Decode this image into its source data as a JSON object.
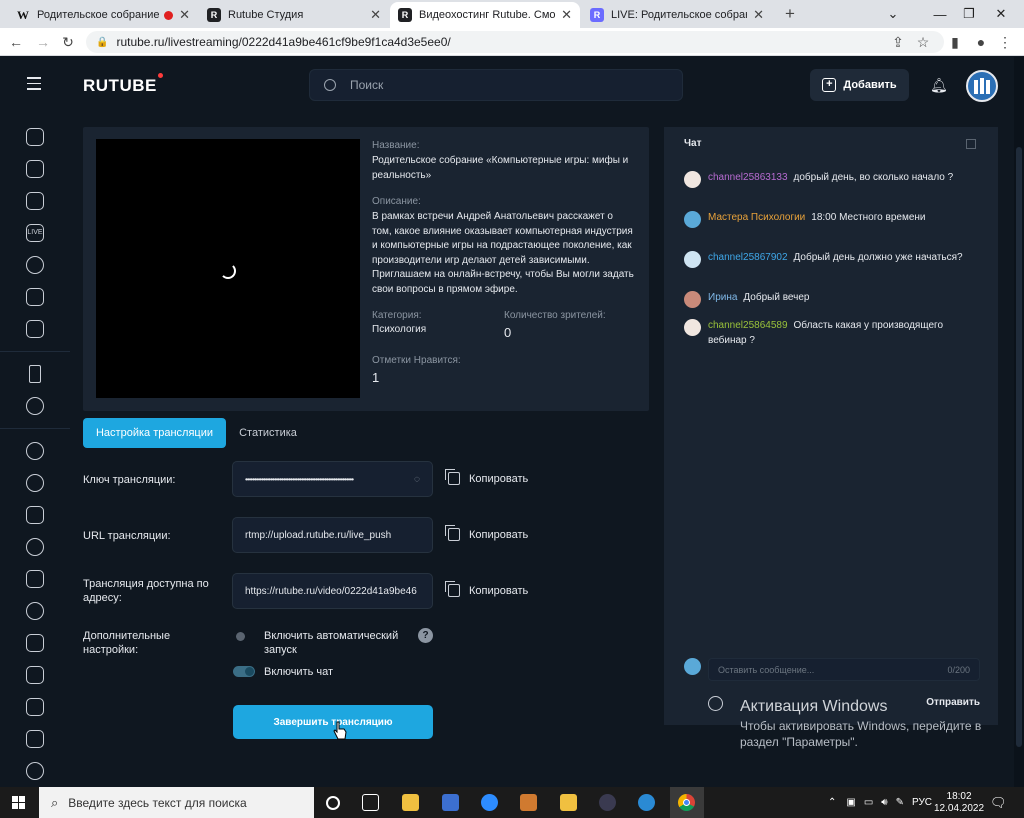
{
  "browser": {
    "tabs": [
      {
        "title": "Родительское собрание «К",
        "favicon": "W"
      },
      {
        "title": "Rutube Студия",
        "favicon": "R"
      },
      {
        "title": "Видеохостинг Rutube. Смотрите",
        "favicon": "R"
      },
      {
        "title": "LIVE: Родительское собрание «К",
        "favicon": "R"
      }
    ],
    "new_tab": "+",
    "url": "rutube.ru/livestreaming/0222d41a9be461cf9be9f1ca4d3e5ee0/"
  },
  "header": {
    "logo": "RUTUBE",
    "search_placeholder": "Поиск",
    "add_label": "Добавить"
  },
  "stream": {
    "name_label": "Название:",
    "name_value": "Родительское собрание «Компьютерные игры: мифы и реальность»",
    "desc_label": "Описание:",
    "desc_value": "В рамках встречи Андрей Анатольевич расскажет о том, какое влияние оказывает компьютерная индустрия и компьютерные игры на подрастающее поколение, как производители игр делают детей зависимыми. Приглашаем на онлайн-встречу, чтобы Вы могли задать свои вопросы в прямом эфире.",
    "category_label": "Категория:",
    "category_value": "Психология",
    "viewers_label": "Количество зрителей:",
    "viewers_value": "0",
    "likes_label": "Отметки Нравится:",
    "likes_value": "1"
  },
  "tabs": {
    "settings": "Настройка трансляции",
    "stats": "Статистика"
  },
  "fields": {
    "key_label": "Ключ трансляции:",
    "key_value": "••••••••••••••••••••••••••••••••••••••••••••••••••••••••••••",
    "url_label": "URL трансляции:",
    "url_value": "rtmp://upload.rutube.ru/live_push",
    "address_label": "Трансляция доступна по адресу:",
    "address_value": "https://rutube.ru/video/0222d41a9be46",
    "copy": "Копировать",
    "extra_label": "Дополнительные настройки:",
    "autostart_label": "Включить автоматический запуск",
    "help": "?",
    "chat_label": "Включить чат",
    "end_button": "Завершить трансляцию"
  },
  "chat": {
    "title": "Чат",
    "messages": [
      {
        "user": "channel25863133",
        "text": "добрый день, во сколько начало ?",
        "color": "#b76bd1"
      },
      {
        "user": "Мастера Психологии",
        "text": "18:00 Местного времени",
        "color": "#e8a23a"
      },
      {
        "user": "channel25867902",
        "text": "Добрый день должно уже начаться?",
        "color": "#3fa7e8"
      },
      {
        "user": "Ирина",
        "text": "Добрый вечер",
        "color": "#7fb8e8"
      },
      {
        "user": "channel25864589",
        "text": "Область какая у производящего вебинар ?",
        "color": "#9ac23a"
      }
    ],
    "input_placeholder": "Оставить сообщение...",
    "counter": "0/200",
    "send": "Отправить"
  },
  "watermark": {
    "title": "Активация Windows",
    "line1": "Чтобы активировать Windows, перейдите в",
    "line2": "раздел \"Параметры\"."
  },
  "taskbar": {
    "search_placeholder": "Введите здесь текст для поиска",
    "lang": "РУС",
    "time": "18:02",
    "date": "12.04.2022"
  },
  "colors": {
    "accent": "#1ea7e0",
    "background": "#0f1720",
    "panel": "#1a2431"
  }
}
